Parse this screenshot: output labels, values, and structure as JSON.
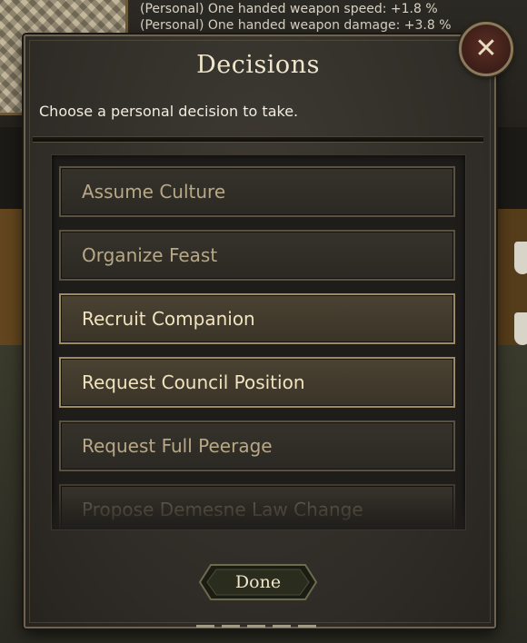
{
  "background": {
    "perks": [
      "(Personal) One handed weapon speed: +1.8 %",
      "(Personal) One handed weapon damage: +3.8 %"
    ]
  },
  "dialog": {
    "title": "Decisions",
    "subtitle": "Choose a personal decision to take.",
    "close_icon": "close-icon",
    "decisions": [
      {
        "label": "Assume Culture",
        "state": "normal"
      },
      {
        "label": "Organize Feast",
        "state": "normal"
      },
      {
        "label": "Recruit Companion",
        "state": "active"
      },
      {
        "label": "Request Council Position",
        "state": "active"
      },
      {
        "label": "Request Full Peerage",
        "state": "normal"
      },
      {
        "label": "Propose Demesne Law Change",
        "state": "faded"
      }
    ],
    "done_label": "Done"
  },
  "colors": {
    "accent": "#f1e3bd",
    "panel": "#2f2c27",
    "close_button": "#3c1e18"
  }
}
